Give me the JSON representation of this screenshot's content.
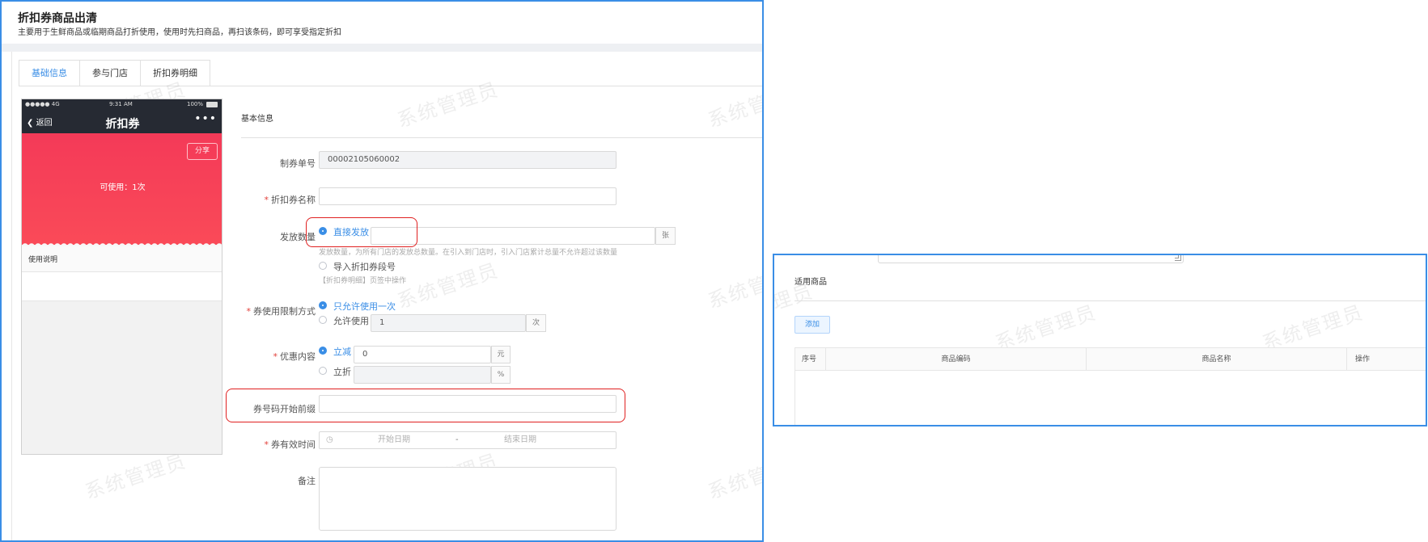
{
  "page": {
    "title": "折扣券商品出清",
    "subtitle": "主要用于生鲜商品或临期商品打折使用，使用时先扫商品，再扫该条码，即可享受指定折扣"
  },
  "tabs": [
    {
      "label": "基础信息",
      "active": true
    },
    {
      "label": "参与门店",
      "active": false
    },
    {
      "label": "折扣券明细",
      "active": false
    }
  ],
  "watermark": "系统管理员",
  "phone": {
    "status_left": "●●●●● 4G",
    "status_time": "9:31 AM",
    "status_battery": "100%",
    "back": "返回",
    "title": "折扣券",
    "more": "•••",
    "share": "分享",
    "available": "可使用：1次",
    "usage": "使用说明"
  },
  "form": {
    "section_title": "基本信息",
    "voucher_no": {
      "label": "制券单号",
      "value": "00002105060002"
    },
    "discount_name": {
      "label": "折扣券名称",
      "value": ""
    },
    "issue_qty": {
      "label": "发放数量",
      "option_direct": "直接发放",
      "unit": "张",
      "hint_direct": "发放数量，为所有门店的发放总数量。在引入到门店时，引入门店累计总量不允许超过该数量",
      "option_import": "导入折扣券段号",
      "hint_import": "【折扣券明细】页签中操作"
    },
    "limit": {
      "label": "券使用限制方式",
      "option_once": "只允许使用一次",
      "option_allow": "允许使用",
      "count": "1",
      "unit": "次"
    },
    "offer": {
      "label": "优惠内容",
      "option_reduce": "立减",
      "reduce_value": "0",
      "reduce_unit": "元",
      "option_discount": "立折",
      "discount_value": "",
      "discount_unit": "%"
    },
    "prefix": {
      "label": "券号码开始前缀",
      "value": ""
    },
    "validity": {
      "label": "券有效时间",
      "start_placeholder": "开始日期",
      "separator": "-",
      "end_placeholder": "结束日期"
    },
    "remark": {
      "label": "备注",
      "value": ""
    }
  },
  "products": {
    "title": "适用商品",
    "add_button": "添加",
    "columns": [
      "序号",
      "商品编码",
      "商品名称",
      "操作"
    ]
  },
  "colors": {
    "accent": "#3a8ee6",
    "highlight": "#e02020",
    "coupon_red": "#f43a58"
  }
}
